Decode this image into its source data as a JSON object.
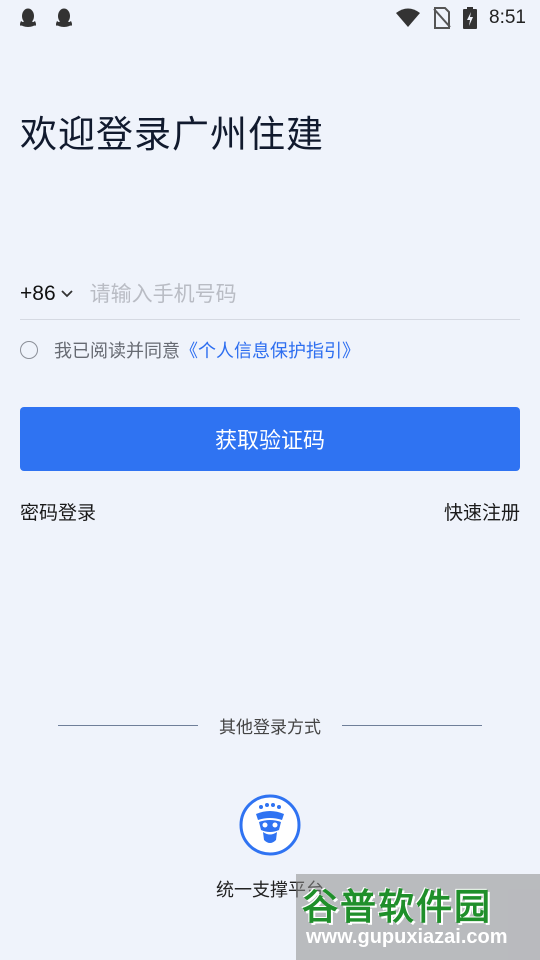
{
  "status_bar": {
    "time": "8:51",
    "left_icons": [
      "qq-icon",
      "qq-icon"
    ],
    "right_icons": [
      "wifi-icon",
      "no-sim-icon",
      "battery-charging-icon"
    ]
  },
  "header": {
    "title": "欢迎登录广州住建"
  },
  "login_form": {
    "country_code": "+86",
    "phone_placeholder": "请输入手机号码",
    "agreement_prefix": "我已阅读并同意",
    "agreement_link": "《个人信息保护指引》",
    "submit_label": "获取验证码",
    "password_login_label": "密码登录",
    "quick_register_label": "快速注册"
  },
  "other_login": {
    "divider_label": "其他登录方式",
    "platform_label": "统一支撑平台"
  },
  "watermark": {
    "brand": "谷普软件园",
    "url": "www.gupuxiazai.com"
  },
  "colors": {
    "background": "#eff3fb",
    "primary": "#2f73f2",
    "link": "#2d6ef0"
  }
}
